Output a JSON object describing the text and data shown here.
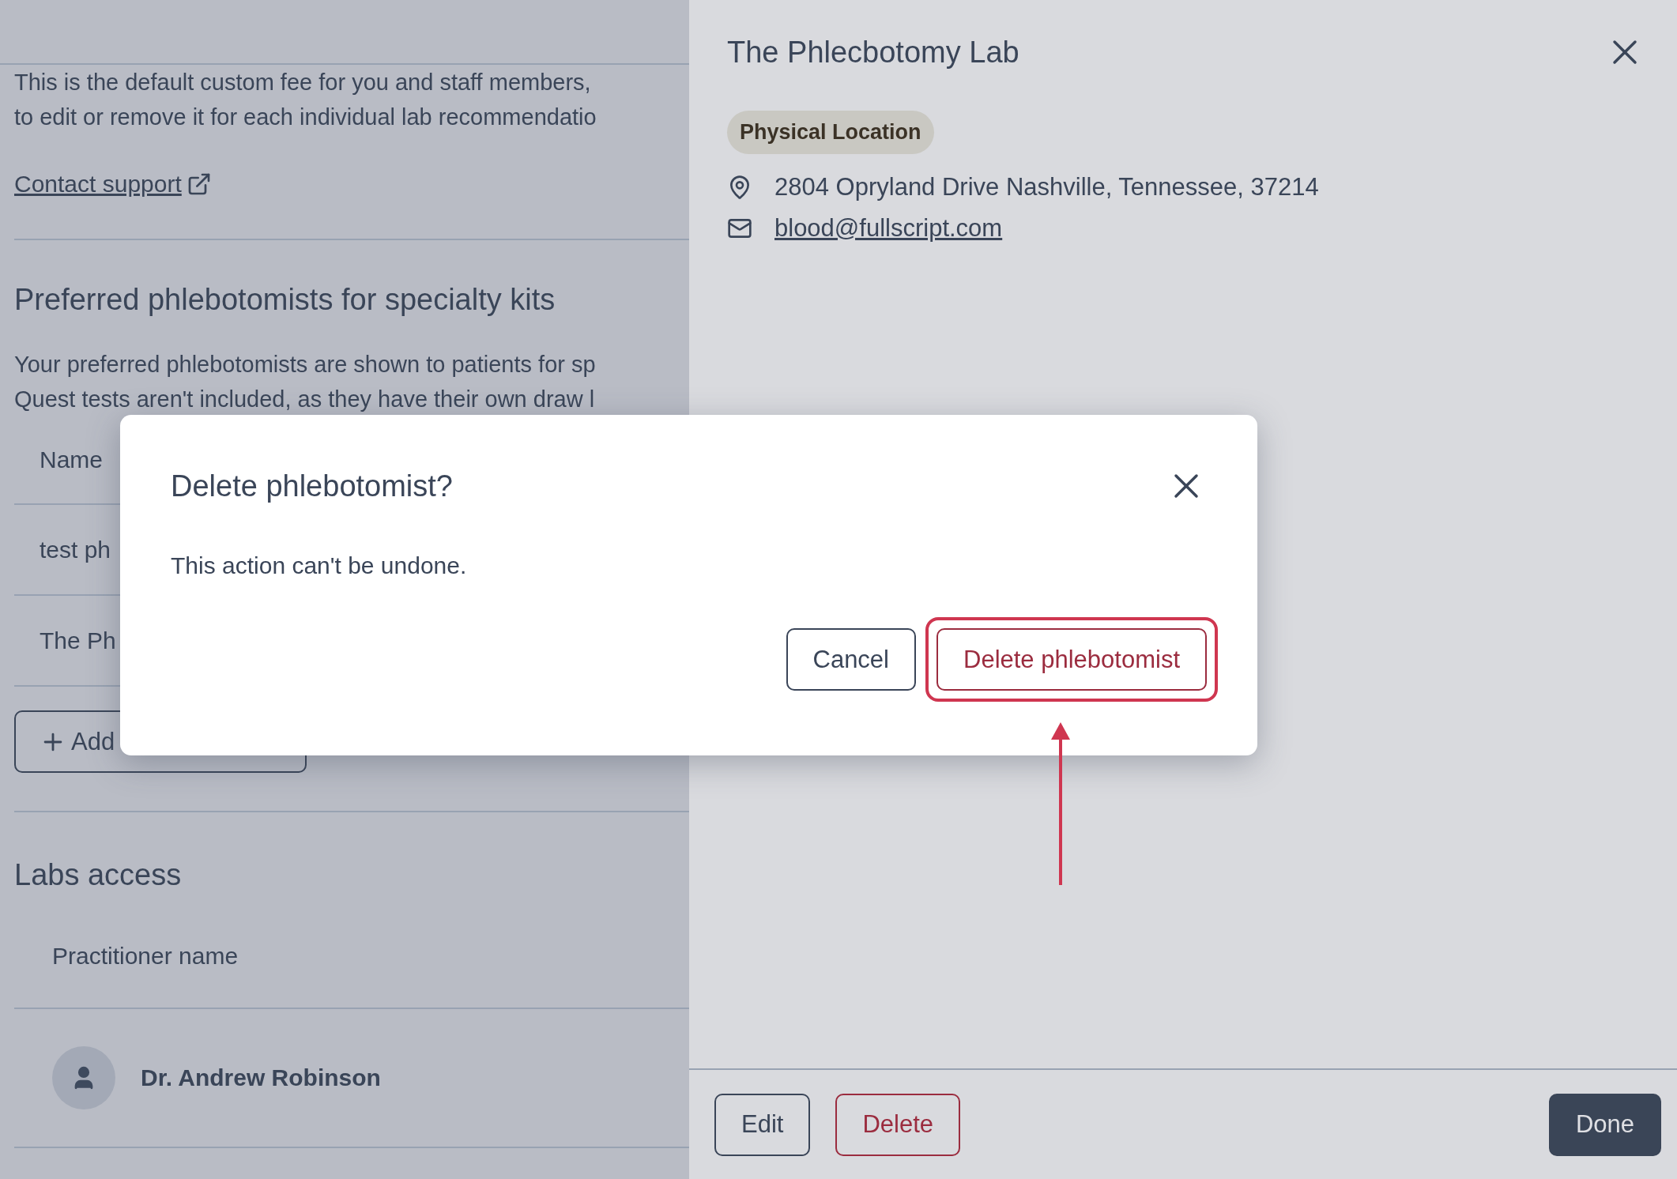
{
  "page": {
    "fee_note": [
      "This is the default custom fee for you and staff members,",
      "to edit or remove it for each individual lab recommendatio"
    ],
    "contact_link": "Contact support",
    "phlebotomists": {
      "heading": "Preferred phlebotomists for specialty kits",
      "description": [
        "Your preferred phlebotomists are shown to patients for sp",
        "Quest tests aren't included, as they have their own draw l"
      ],
      "column": "Name",
      "rows": [
        "test ph",
        "The Ph"
      ],
      "add_button": "Add"
    },
    "labs_access": {
      "heading": "Labs access",
      "column": "Practitioner name",
      "rows": [
        {
          "name": "Dr. Andrew Robinson"
        }
      ]
    }
  },
  "drawer": {
    "title": "The Phlecbotomy Lab",
    "badge": "Physical Location",
    "address": "2804 Opryland Drive Nashville, Tennessee, 37214",
    "email": "blood@fullscript.com",
    "buttons": [
      {
        "label": "Edit",
        "kind": "secondary"
      },
      {
        "label": "Delete",
        "kind": "danger"
      },
      {
        "label": "Done",
        "kind": "primary"
      }
    ]
  },
  "dialog": {
    "title": "Delete phlebotomist?",
    "message": "This action can't be undone.",
    "buttons": [
      {
        "label": "Cancel",
        "kind": "secondary",
        "highlighted": false
      },
      {
        "label": "Delete phlebotomist",
        "kind": "danger",
        "highlighted": true
      }
    ]
  }
}
